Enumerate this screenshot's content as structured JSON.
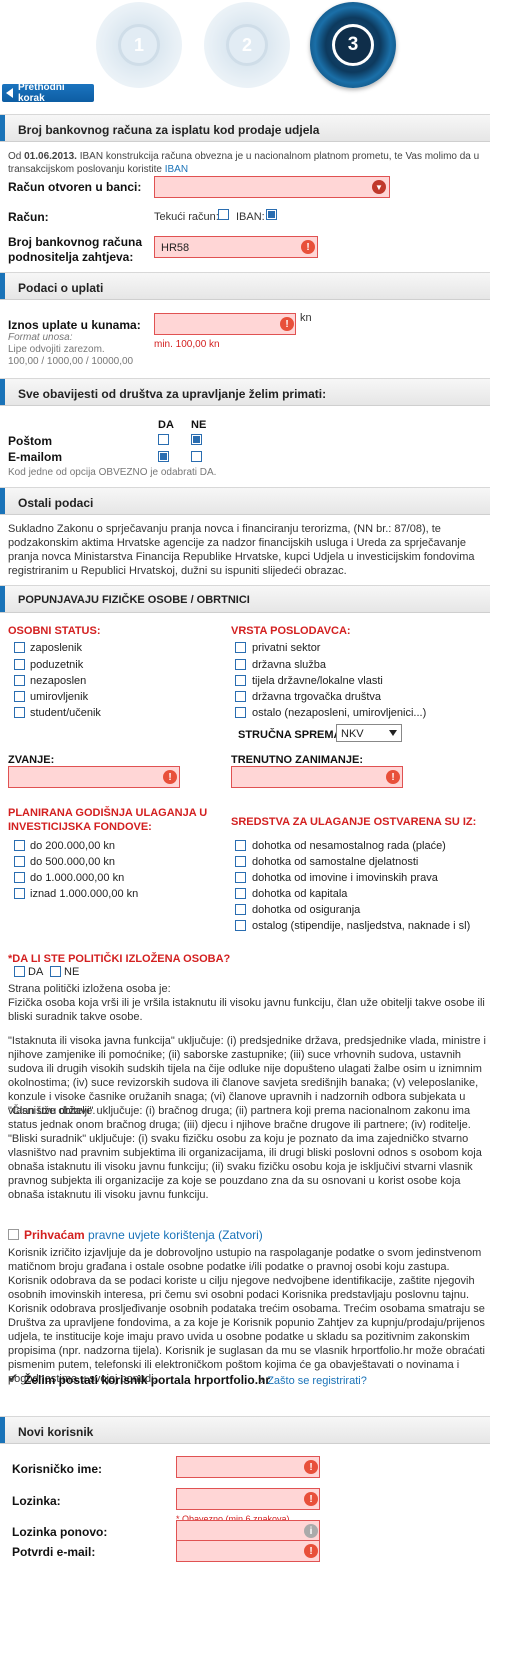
{
  "steps": [
    "1",
    "2",
    "3"
  ],
  "prev_step_label": "Prethodni korak",
  "bank_section": {
    "title": "Broj bankovnog računa za isplatu kod prodaje udjela",
    "iban_note_prefix": "Od ",
    "iban_note_date": "01.06.2013.",
    "iban_note_text": " IBAN konstrukcija računa obvezna je u nacionalnom platnom prometu, te Vas molimo da u transakcijskom poslovanju koristite ",
    "iban_link": "IBAN",
    "bank_label": "Račun otvoren u banci:",
    "account_label": "Račun:",
    "current_account": "Tekući račun:",
    "iban_option": "IBAN:",
    "account_number_label": "Broj bankovnog računa podnositelja zahtjeva:",
    "account_number_value": "HR58"
  },
  "payment_section": {
    "title": "Podaci o uplati",
    "amount_label": "Iznos uplate u kunama:",
    "format_label": "Format unosa:",
    "format_hint": "Lipe odvojiti zarezom.",
    "format_example": "100,00 / 1000,00 / 10000,00",
    "currency": "kn",
    "min_note": "min. 100,00 kn"
  },
  "notify_section": {
    "title": "Sve obavijesti od društva za upravljanje želim primati:",
    "yes": "DA",
    "no": "NE",
    "post_label": "Poštom",
    "email_label": "E-mailom",
    "note": "Kod jedne od opcija OBVEZNO je odabrati DA."
  },
  "other_section": {
    "title": "Ostali podaci",
    "text": "Sukladno Zakonu o sprječavanju pranja novca i financiranju terorizma, (NN br.: 87/08), te podzakonskim aktima Hrvatske agencije za nadzor financijskih usluga i Ureda za sprječavanje pranja novca Ministarstva Financija Republike Hrvatske, kupci Udjela u investicijskim fondovima registriranim u Republici Hrvatskoj, dužni su ispuniti slijedeći obrazac."
  },
  "individuals_section": {
    "title": "POPUNJAVAJU FIZIČKE OSOBE / OBRTNICI",
    "personal_status_title": "OSOBNI STATUS:",
    "personal_status": [
      "zaposlenik",
      "poduzetnik",
      "nezaposlen",
      "umirovljenik",
      "student/učenik"
    ],
    "employer_type_title": "VRSTA POSLODAVCA:",
    "employer_types": [
      "privatni sektor",
      "državna služba",
      "tijela državne/lokalne vlasti",
      "državna trgovačka društva",
      "ostalo (nezaposleni, umirovljenici...)"
    ],
    "qualification_label": "STRUČNA SPREMA:",
    "qualification_value": "NKV",
    "title_label": "ZVANJE:",
    "occupation_label": "TRENUTNO ZANIMANJE:",
    "planned_investment_title": "PLANIRANA GODIŠNJA ULAGANJA U INVESTICIJSKA FONDOVE:",
    "planned_investment": [
      "do 200.000,00 kn",
      "do 500.000,00 kn",
      "do 1.000.000,00 kn",
      "iznad 1.000.000,00 kn"
    ],
    "funds_source_title": "SREDSTVA ZA ULAGANJE OSTVARENA SU IZ:",
    "funds_source": [
      "dohotka od nesamostalnog rada (plaće)",
      "dohotka od samostalne djelatnosti",
      "dohotka od imovine i imovinskih prava",
      "dohotka od kapitala",
      "dohotka od osiguranja",
      "ostalog (stipendije, nasljedstva, naknade i sl)"
    ],
    "pep_question": "*DA LI STE POLITIČKI IZLOŽENA OSOBA?",
    "pep_yes": "DA",
    "pep_no": "NE",
    "pep_text": [
      "Strana politički izložena osoba je:",
      "Fizička osoba koja vrši ili je vršila istaknutu ili visoku javnu funkciju, član uže obitelji takve osobe ili bliski suradnik takve osobe.",
      "\"Istaknuta ili visoka javna funkcija\" uključuje: (i) predsjednike država, predsjednike vlada, ministre i njihove zamjenike ili pomoćnike; (ii) saborske zastupnike; (iii) suce vrhovnih sudova, ustavnih sudova ili drugih visokih sudskih tijela na čije odluke nije dopušteno ulagati žalbe osim u iznimnim okolnostima; (iv) suce revizorskih sudova ili članove savjeta središnjih banaka; (v) veleposlanike, konzule i visoke časnike oružanih snaga; (vi) članove upravnih i nadzornih odbora subjekata u vlasništvu države.",
      "\"Član uže obitelji\" uključuje: (i) bračnog druga; (ii) partnera koji prema nacionalnom zakonu ima status jednak onom bračnog druga; (iii) djecu i njihove bračne drugove ili partnere; (iv) roditelje.",
      "\"Bliski suradnik\" uključuje: (i) svaku fizičku osobu za koju je poznato da ima zajedničko stvarno vlasništvo nad pravnim subjektima ili organizacijama, ili drugi bliski poslovni odnos s osobom koja obnaša istaknutu ili visoku javnu funkciju; (ii) svaku fizičku osobu koja je isključivi stvarni vlasnik pravnog subjekta ili organizacije za koje se pouzdano zna da su osnovani u korist osobe koja obnaša istaknutu ili visoku javnu funkciju."
    ]
  },
  "terms": {
    "accept": "Prihvaćam",
    "terms_link": "pravne uvjete korištenja (Zatvori)",
    "text": "Korisnik izričito izjavljuje da je dobrovoljno ustupio na raspolaganje podatke o svom jedinstvenom matičnom broju građana i ostale osobne podatke i/ili podatke o pravnoj osobi koju zastupa. Korisnik odobrava da se podaci koriste u cilju njegove nedvojbene identifikacije, zaštite njegovih osobnih imovinskih interesa, pri čemu svi osobni podaci Korisnika predstavljaju poslovnu tajnu. Korisnik odobrava prosljeđivanje osobnih podataka trećim osobama. Trećim osobama smatraju se Društva za upravljene fondovima, a za koje je Korisnik popunio Zahtjev za kupnju/prodaju/prijenos udjela, te institucije koje imaju pravo uvida u osobne podatke u skladu sa pozitivnim zakonskim propisima (npr. nadzorna tijela). Korisnik je suglasan da mu se vlasnik hrportfolio.hr može obraćati pismenim putem, telefonski ili elektroničkom poštom kojima će ga obavještavati o novinama i pogodnostima u svojoj ponudi.",
    "portal_user": "Želim postati korisnik portala hrportfolio.hr",
    "why_register": "Zašto se registrirati?"
  },
  "new_user_section": {
    "title": "Novi korisnik",
    "username_label": "Korisničko ime:",
    "password_label": "Lozinka:",
    "password_note": "* Obavezno (min 6 znakova).",
    "password_repeat_label": "Lozinka ponovo:",
    "email_confirm_label": "Potvrdi e-mail:"
  },
  "colors": {
    "accent": "#1a73b8",
    "error": "#d32020",
    "field_bg": "#ffd6d6"
  }
}
